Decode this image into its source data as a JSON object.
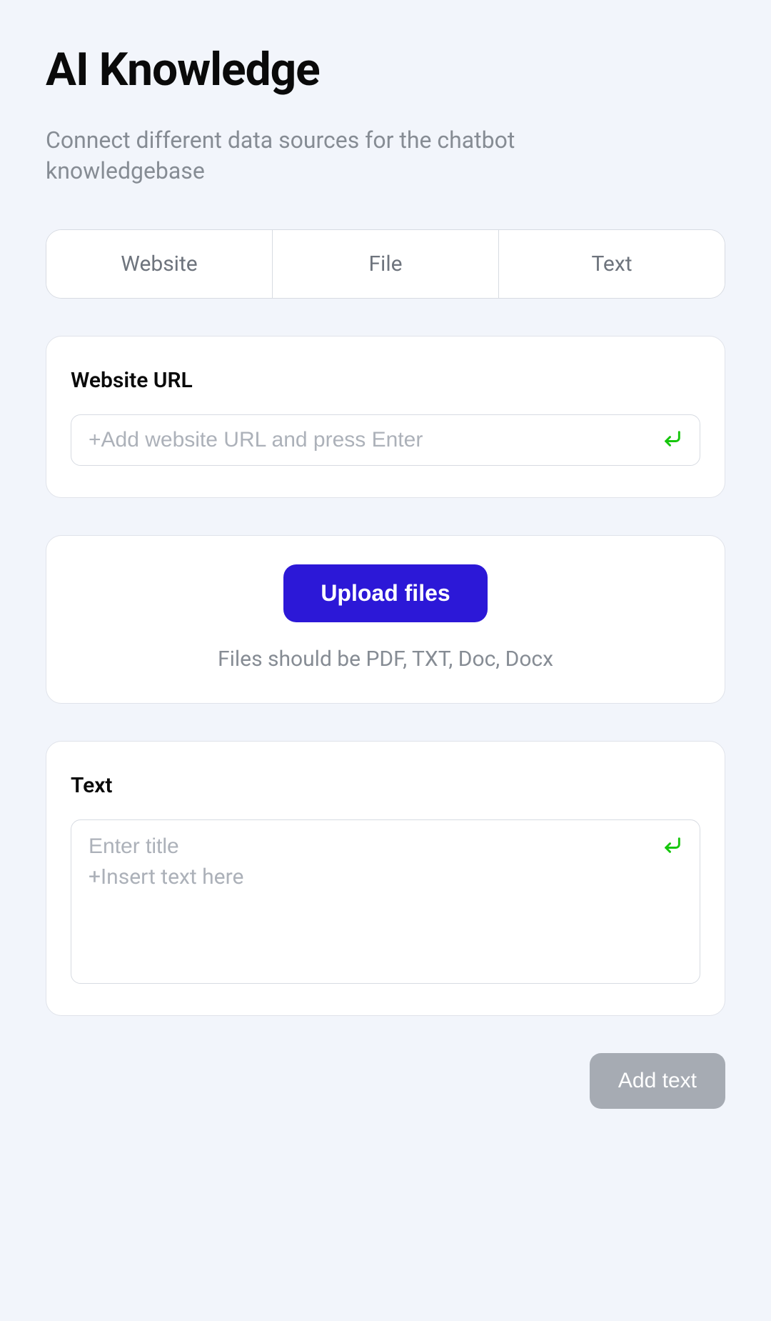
{
  "header": {
    "title": "AI Knowledge",
    "subtitle": "Connect different data sources for the chatbot knowledgebase"
  },
  "tabs": {
    "items": [
      {
        "label": "Website"
      },
      {
        "label": "File"
      },
      {
        "label": "Text"
      }
    ]
  },
  "website_card": {
    "title": "Website URL",
    "placeholder": "+Add website URL and press Enter"
  },
  "upload_card": {
    "button_label": "Upload files",
    "hint": "Files should be PDF, TXT, Doc, Docx"
  },
  "text_card": {
    "title": "Text",
    "title_placeholder": "Enter title",
    "body_placeholder": "+Insert text here"
  },
  "footer": {
    "add_text_label": "Add text"
  },
  "colors": {
    "bg": "#f2f5fb",
    "primary": "#2c18d7",
    "accent_green": "#16c60c",
    "muted_text": "#868c94",
    "placeholder": "#acb1b9",
    "border": "#d7dbe2",
    "disabled_btn": "#a6abb3"
  }
}
